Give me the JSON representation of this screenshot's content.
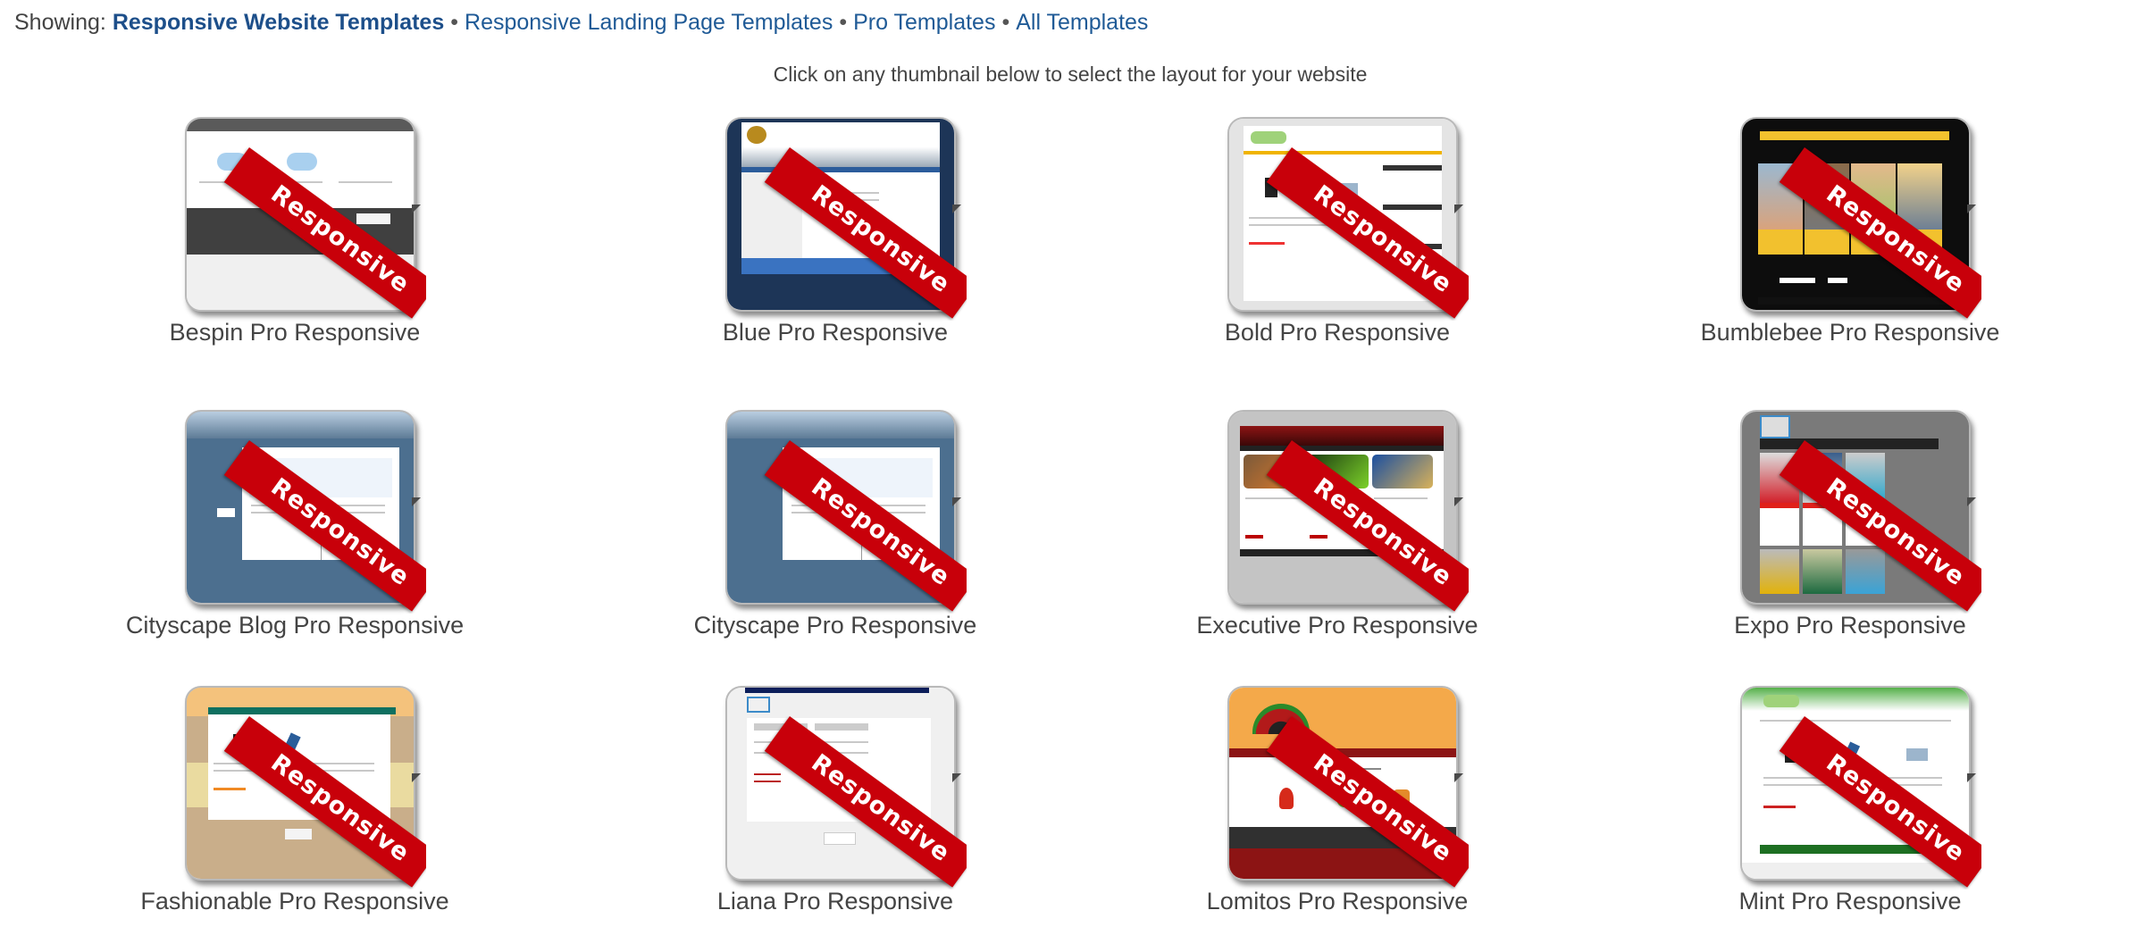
{
  "filter_bar": {
    "prefix": "Showing:",
    "separator": "•",
    "links": [
      {
        "label": "Responsive Website Templates",
        "active": true
      },
      {
        "label": "Responsive Landing Page Templates",
        "active": false
      },
      {
        "label": "Pro Templates",
        "active": false
      },
      {
        "label": "All Templates",
        "active": false
      }
    ]
  },
  "instruction": "Click on any thumbnail below to select the layout for your website",
  "ribbon_text": "Responsive",
  "ribbon_color": "#c8000a",
  "link_color": "#1f5a96",
  "templates": [
    {
      "name": "Bespin Pro Responsive",
      "theme": "bespin"
    },
    {
      "name": "Blue Pro Responsive",
      "theme": "blue"
    },
    {
      "name": "Bold Pro Responsive",
      "theme": "bold"
    },
    {
      "name": "Bumblebee Pro Responsive",
      "theme": "bumblebee"
    },
    {
      "name": "Cityscape Blog Pro Responsive",
      "theme": "cityscape-blog"
    },
    {
      "name": "Cityscape Pro Responsive",
      "theme": "cityscape"
    },
    {
      "name": "Executive Pro Responsive",
      "theme": "executive"
    },
    {
      "name": "Expo Pro Responsive",
      "theme": "expo"
    },
    {
      "name": "Fashionable Pro Responsive",
      "theme": "fashionable"
    },
    {
      "name": "Liana Pro Responsive",
      "theme": "liana"
    },
    {
      "name": "Lomitos Pro Responsive",
      "theme": "lomitos"
    },
    {
      "name": "Mint Pro Responsive",
      "theme": "mint"
    }
  ]
}
